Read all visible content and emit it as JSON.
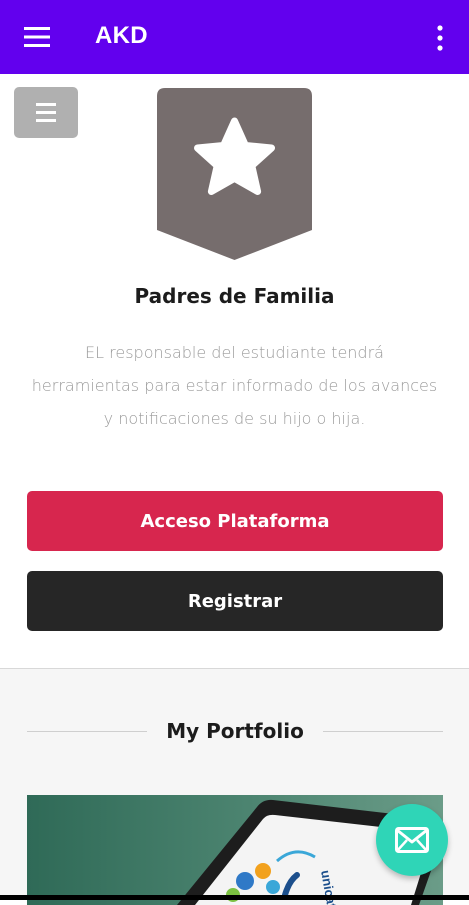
{
  "colors": {
    "accent": "#6200ee",
    "primary": "#d7264e",
    "dark": "#262626",
    "fab": "#2fd5b7",
    "badge": "#766d6d"
  },
  "appbar": {
    "title": "AKD",
    "menu_icon": "hamburger-menu-icon",
    "overflow_icon": "more-vertical-icon"
  },
  "sidebar_toggle": {
    "icon": "hamburger-menu-icon"
  },
  "badge": {
    "icon": "star-icon"
  },
  "section": {
    "title": "Padres de Familia",
    "description": "EL responsable del estudiante tendrá herramientas para estar informado de los avances y notificaciones de su hijo o hija."
  },
  "buttons": {
    "access_label": "Acceso Plataforma",
    "register_label": "Registrar"
  },
  "portfolio": {
    "heading": "My Portfolio",
    "card_text": "unicate"
  },
  "fab": {
    "icon": "mail-icon"
  }
}
